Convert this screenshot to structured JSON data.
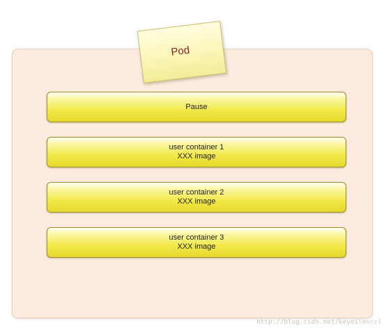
{
  "diagram": {
    "pod_label": "Pod",
    "containers": [
      {
        "name": "Pause",
        "image": ""
      },
      {
        "name": "user container 1",
        "image": "XXX image"
      },
      {
        "name": "user container 2",
        "image": "XXX image"
      },
      {
        "name": "user container 3",
        "image": "XXX image"
      }
    ],
    "watermark": "http://blog.csdn.net/keyeilenccl"
  },
  "colors": {
    "pod_background": "#fcebde",
    "note_label": "#8b1f1f",
    "container_fill": "#f2e94a"
  }
}
